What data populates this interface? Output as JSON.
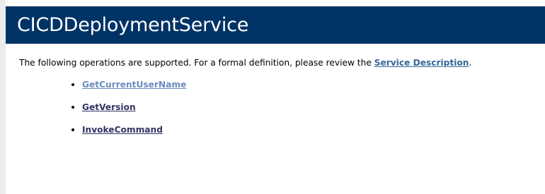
{
  "header": {
    "title": "CICDDeploymentService"
  },
  "intro": {
    "text": "The following operations are supported. For a formal definition, please review the ",
    "link_label": "Service Description",
    "trailing": "."
  },
  "operations": [
    {
      "label": "GetCurrentUserName"
    },
    {
      "label": "GetVersion"
    },
    {
      "label": "InvokeCommand"
    }
  ],
  "colors": {
    "header_background": "#003366",
    "header_text": "#ffffff",
    "link": "#336699",
    "operation_link": "#333366",
    "operation_link_light": "#6b8cc0"
  }
}
